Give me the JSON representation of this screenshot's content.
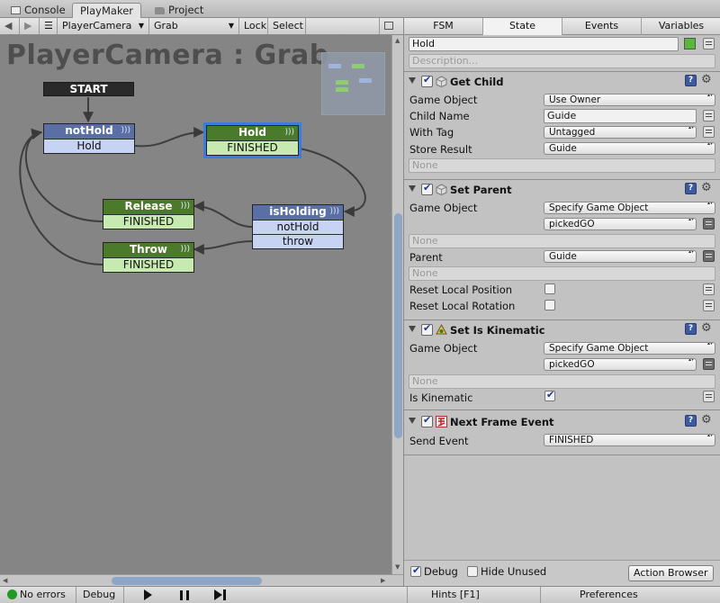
{
  "window_tabs": [
    {
      "label": "Console",
      "icon": "console-icon"
    },
    {
      "label": "PlayMaker",
      "icon": ""
    },
    {
      "label": "Project",
      "icon": "folder-icon"
    }
  ],
  "toolbar": {
    "back": "◀",
    "forward": "▶",
    "menu": "☰",
    "fsm_select": "PlayerCamera",
    "state_select": "Grab",
    "lock": "Lock",
    "select": "Select"
  },
  "graph": {
    "title": "PlayerCamera : Grab",
    "start_label": "START",
    "states": [
      {
        "id": "notHold",
        "name": "notHold",
        "color": "blue",
        "events": [
          "Hold"
        ]
      },
      {
        "id": "Hold",
        "name": "Hold",
        "color": "green",
        "events": [
          "FINISHED"
        ],
        "selected": true
      },
      {
        "id": "Release",
        "name": "Release",
        "color": "green",
        "events": [
          "FINISHED"
        ]
      },
      {
        "id": "isHolding",
        "name": "isHolding",
        "color": "blue",
        "events": [
          "notHold",
          "throw"
        ]
      },
      {
        "id": "Throw",
        "name": "Throw",
        "color": "green",
        "events": [
          "FINISHED"
        ]
      }
    ]
  },
  "inspector": {
    "tabs": [
      "FSM",
      "State",
      "Events",
      "Variables"
    ],
    "active_tab": "State",
    "state_name": "Hold",
    "state_color": "#58b83a",
    "description_placeholder": "Description...",
    "actions": [
      {
        "name": "Get Child",
        "icon": "gameobject-icon",
        "rows": [
          {
            "label": "Game Object",
            "value": "Use Owner",
            "kind": "dropdown"
          },
          {
            "label": "Child Name",
            "value": "Guide",
            "kind": "text"
          },
          {
            "label": "With Tag",
            "value": "Untagged",
            "kind": "dropdown"
          },
          {
            "label": "Store Result",
            "value": "Guide",
            "kind": "dropdown"
          }
        ],
        "none": "None"
      },
      {
        "name": "Set Parent",
        "icon": "gameobject-icon",
        "game_object_label": "Game Object",
        "game_object_mode": "Specify Game Object",
        "game_object_var": "pickedGO",
        "none1": "None",
        "parent_label": "Parent",
        "parent_value": "Guide",
        "none2": "None",
        "reset_pos_label": "Reset Local Position",
        "reset_rot_label": "Reset Local Rotation"
      },
      {
        "name": "Set Is Kinematic",
        "icon": "physics-icon",
        "game_object_label": "Game Object",
        "game_object_mode": "Specify Game Object",
        "game_object_var": "pickedGO",
        "none": "None",
        "kinematic_label": "Is Kinematic",
        "kinematic_checked": true
      },
      {
        "name": "Next Frame Event",
        "icon": "event-icon",
        "send_label": "Send Event",
        "send_value": "FINISHED"
      }
    ],
    "debug_label": "Debug",
    "debug_checked": true,
    "hide_unused_label": "Hide Unused",
    "hide_unused_checked": false,
    "action_browser": "Action Browser"
  },
  "statusbar": {
    "errors": "No errors",
    "debug": "Debug",
    "hints": "Hints [F1]",
    "preferences": "Preferences"
  }
}
